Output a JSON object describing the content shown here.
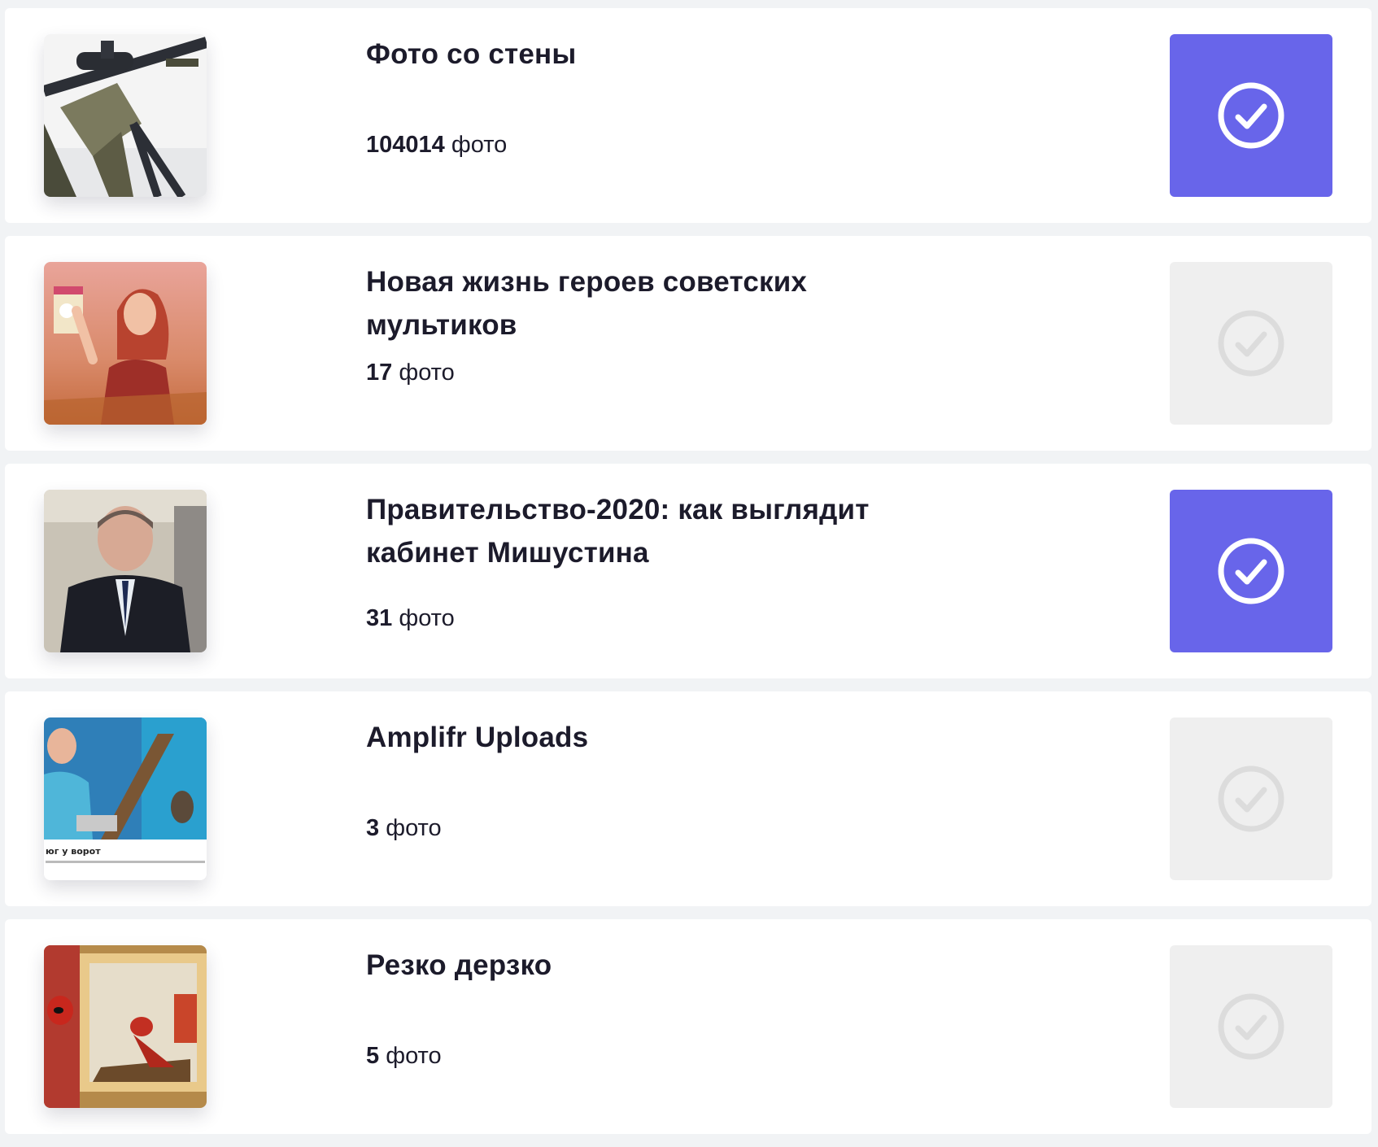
{
  "albums": [
    {
      "title": "Фото со стены",
      "count": "104014",
      "unit": "фото",
      "selected": true,
      "thumbnail": "rifle-photo"
    },
    {
      "title": "Новая жизнь героев советских мультиков",
      "count": "17",
      "unit": "фото",
      "selected": false,
      "thumbnail": "cartoon-woman-photo"
    },
    {
      "title": "Правительство-2020: как выглядит кабинет Мишустина",
      "count": "31",
      "unit": "фото",
      "selected": true,
      "thumbnail": "man-in-suit-photo"
    },
    {
      "title": "Amplifr Uploads",
      "count": "3",
      "unit": "фото",
      "selected": false,
      "thumbnail": "woman-at-stairs-photo",
      "thumbnail_caption": "юг у ворот"
    },
    {
      "title": "Резко дерзко",
      "count": "5",
      "unit": "фото",
      "selected": false,
      "thumbnail": "deadpool-painting-photo"
    }
  ],
  "colors": {
    "selected": "#6865ea",
    "unselected": "#efefef",
    "text": "#1c1b2b"
  }
}
